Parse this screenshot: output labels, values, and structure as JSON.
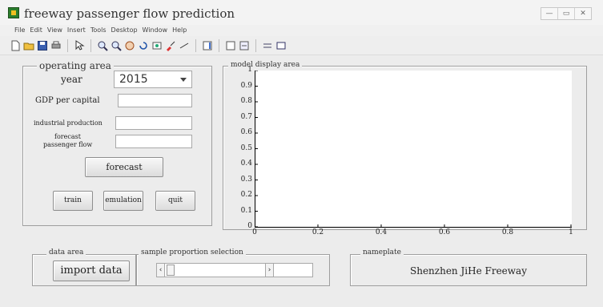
{
  "window": {
    "title": "freeway passenger flow prediction",
    "controls": [
      "—",
      "▭",
      "✕"
    ]
  },
  "menu": [
    "File",
    "Edit",
    "View",
    "Insert",
    "Tools",
    "Desktop",
    "Window",
    "Help"
  ],
  "toolbar_icons": [
    "new-file-icon",
    "open-folder-icon",
    "save-icon",
    "print-icon",
    "pointer-icon",
    "zoom-in-icon",
    "zoom-out-icon",
    "pan-icon",
    "rotate-icon",
    "data-cursor-icon",
    "brush-icon",
    "link-icon",
    "colorbar-icon",
    "legend-icon",
    "hide-plot-tools-icon",
    "show-plot-tools-icon"
  ],
  "operating_area": {
    "legend": "operating area",
    "year_label": "year",
    "year_value": "2015",
    "gdp_label": "GDP per capital",
    "gdp_value": "",
    "industrial_label": "industrial production",
    "industrial_value": "",
    "forecast_label_1": "forecast",
    "forecast_label_2": "passenger flow",
    "forecast_value": "",
    "forecast_button": "forecast",
    "train_button": "train",
    "emulation_button": "emulation",
    "quit_button": "quit"
  },
  "display_area": {
    "legend": "model display area"
  },
  "chart_data": {
    "type": "line",
    "title": "",
    "xlabel": "",
    "ylabel": "",
    "xlim": [
      0,
      1
    ],
    "ylim": [
      0,
      1
    ],
    "x_ticks": [
      "0",
      "0.2",
      "0.4",
      "0.6",
      "0.8",
      "1"
    ],
    "y_ticks": [
      "0",
      "0.1",
      "0.2",
      "0.3",
      "0.4",
      "0.5",
      "0.6",
      "0.7",
      "0.8",
      "0.9",
      "1"
    ],
    "series": []
  },
  "data_area": {
    "legend": "data area",
    "import_button": "import data"
  },
  "sample_selection": {
    "legend": "sample proportion selection",
    "left_arrow": "‹",
    "right_arrow": "›",
    "value_text": ""
  },
  "nameplate": {
    "legend": "nameplate",
    "text": "Shenzhen JiHe Freeway"
  }
}
